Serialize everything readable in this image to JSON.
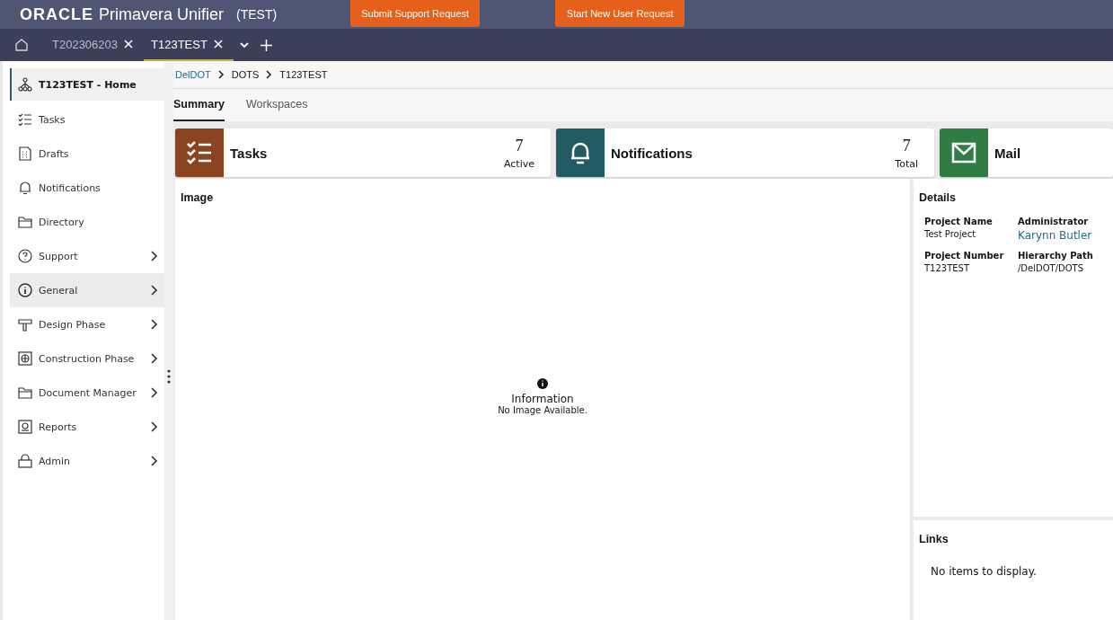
{
  "header": {
    "brand": "ORACLE",
    "product": "Primavera Unifier",
    "environment": "(TEST)",
    "buttons": [
      "Submit Support Request",
      "Start New User Request"
    ]
  },
  "tabs": [
    {
      "label": "T202306203",
      "selected": false,
      "closable": true
    },
    {
      "label": "T123TEST",
      "selected": true,
      "closable": true
    }
  ],
  "sidebar": {
    "items": [
      {
        "label": "T123TEST - Home",
        "selected": true,
        "expandable": false
      },
      {
        "label": "Tasks",
        "selected": false,
        "expandable": false
      },
      {
        "label": "Drafts",
        "selected": false,
        "expandable": false
      },
      {
        "label": "Notifications",
        "selected": false,
        "expandable": false
      },
      {
        "label": "Directory",
        "selected": false,
        "expandable": false
      },
      {
        "label": "Support",
        "selected": false,
        "expandable": true
      },
      {
        "label": "General",
        "selected": false,
        "hovered": true,
        "expandable": true
      },
      {
        "label": "Design Phase",
        "selected": false,
        "expandable": true
      },
      {
        "label": "Construction Phase",
        "selected": false,
        "expandable": true
      },
      {
        "label": "Document Manager",
        "selected": false,
        "expandable": true
      },
      {
        "label": "Reports",
        "selected": false,
        "expandable": true
      },
      {
        "label": "Admin",
        "selected": false,
        "expandable": true
      }
    ]
  },
  "breadcrumb": [
    {
      "label": "DelDOT",
      "link": true
    },
    {
      "label": "DOTS",
      "link": false
    },
    {
      "label": "T123TEST",
      "link": false
    }
  ],
  "page_tabs": [
    {
      "label": "Summary",
      "selected": true
    },
    {
      "label": "Workspaces",
      "selected": false
    }
  ],
  "widgets": [
    {
      "title": "Tasks",
      "color": "#8a4420",
      "count": "7",
      "count_label": "Active"
    },
    {
      "title": "Notifications",
      "color": "#235b62",
      "count": "7",
      "count_label": "Total"
    },
    {
      "title": "Mail",
      "color": "#2f7d45"
    }
  ],
  "image_panel": {
    "title": "Image",
    "message_title": "Information",
    "message": "No Image Available."
  },
  "details": {
    "title": "Details",
    "fields": [
      {
        "label": "Project Name",
        "value": "Test Project",
        "link": false
      },
      {
        "label": "Administrator",
        "value": "Karynn Butler",
        "link": true
      },
      {
        "label": "Project Number",
        "value": "T123TEST",
        "link": false
      },
      {
        "label": "Hierarchy Path",
        "value": "/DelDOT/DOTS",
        "link": false
      }
    ]
  },
  "links": {
    "title": "Links",
    "empty_message": "No items to display."
  }
}
